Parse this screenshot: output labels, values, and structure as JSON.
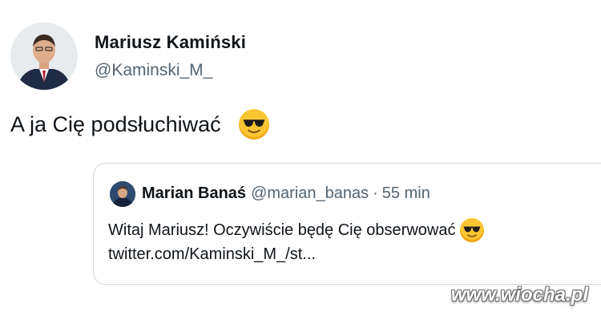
{
  "tweet": {
    "author": {
      "name": "Mariusz Kamiński",
      "handle": "@Kaminski_M_"
    },
    "text": "A ja Cię podsłuchiwać",
    "emoji": "sunglasses-emoji",
    "quote": {
      "author_name": "Marian Banaś",
      "author_handle": "@marian_banas",
      "separator": "·",
      "time": "55 min",
      "text_line1": "Witaj Mariusz! Oczywiście będę Cię obserwować",
      "text_line2": "twitter.com/Kaminski_M_/st..."
    }
  },
  "watermark": {
    "text": "www.wiocha.pl"
  },
  "colors": {
    "text_primary": "#0f1419",
    "text_secondary": "#536471",
    "border": "#cfd9de",
    "emoji_yellow": "#fbc531"
  }
}
